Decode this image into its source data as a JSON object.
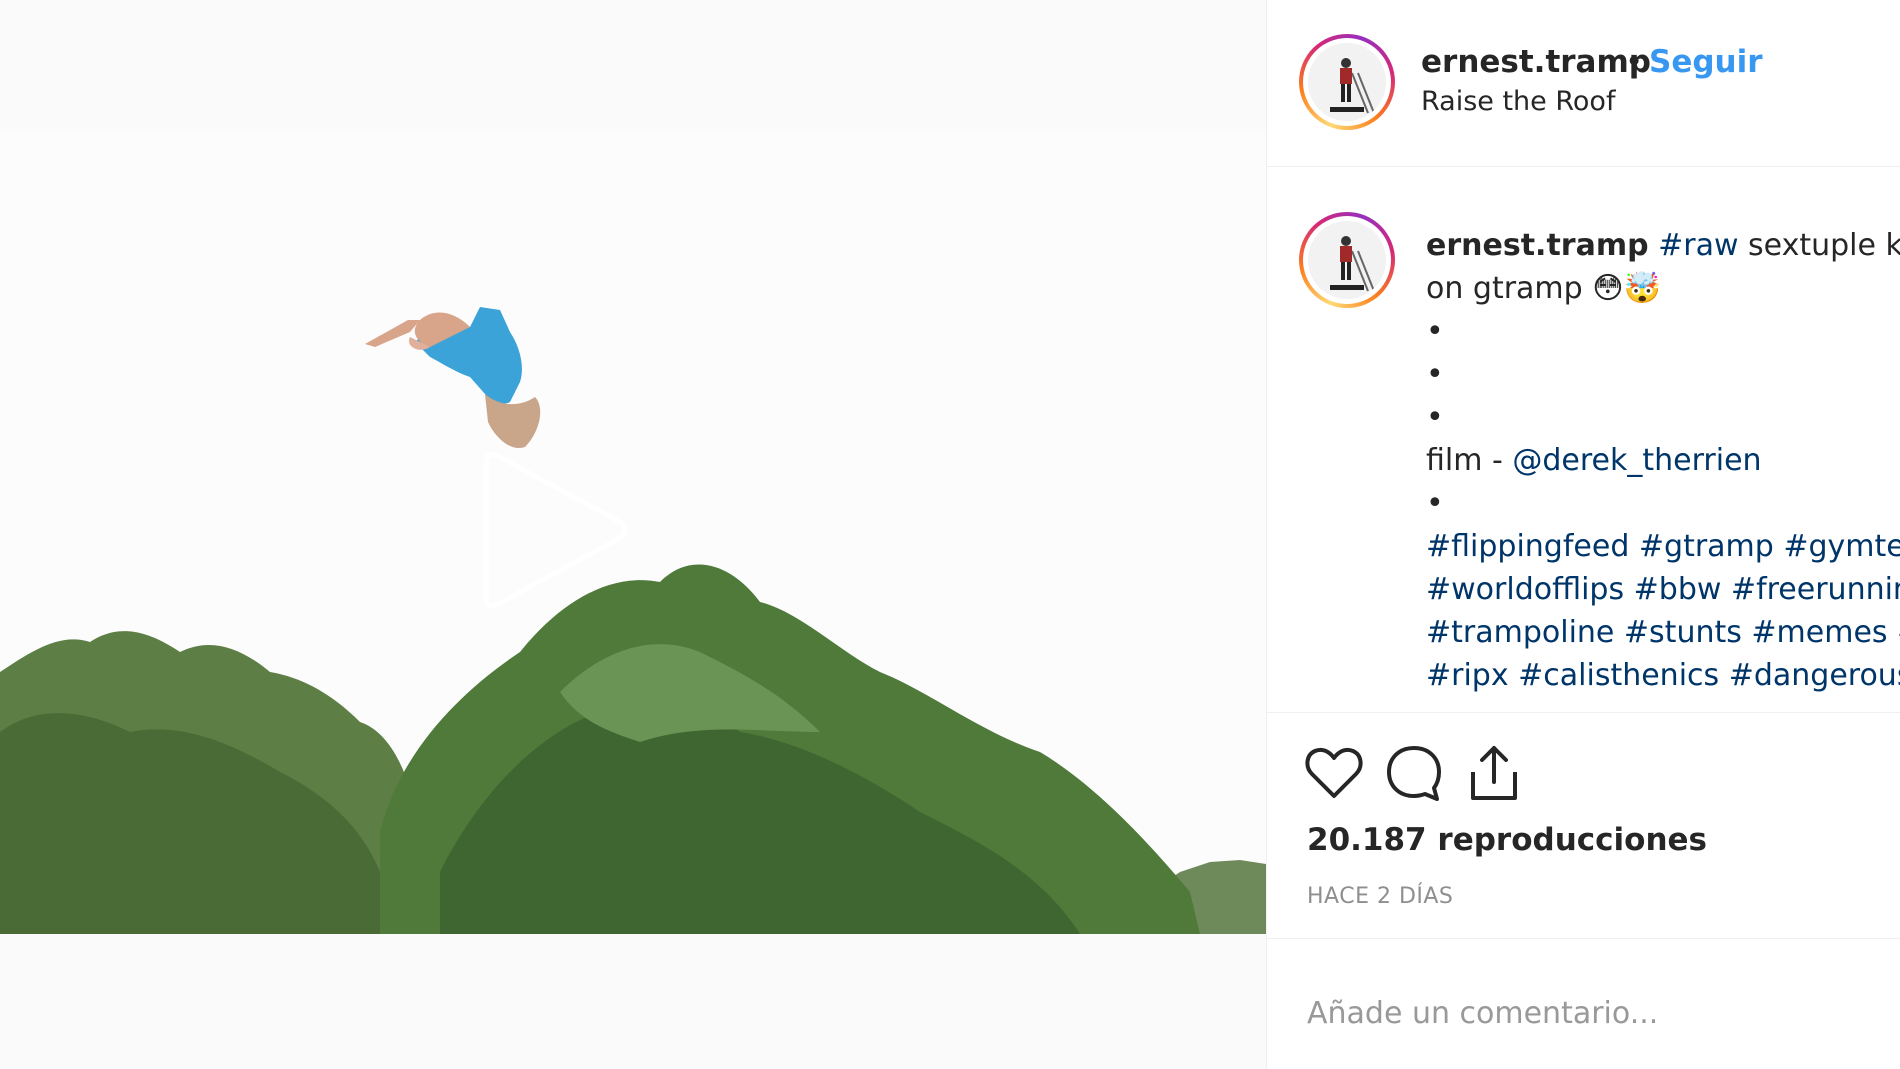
{
  "post": {
    "username": "ernest.tramp",
    "separator": "•",
    "follow_label": "Seguir",
    "location": "Raise the Roof"
  },
  "caption": {
    "username": "ernest.tramp",
    "line1_tag": "#raw",
    "line1_text": " sextuple kabo",
    "line2_text": "on gtramp ",
    "line2_emoji": "😳🤯",
    "bullet": "•",
    "film_prefix": "film - ",
    "film_mention": "@derek_therrien",
    "hashtag_lines": [
      "#flippingfeed #gtramp #gymterr",
      "#worldofflips #bbw #freerunning",
      "#trampoline #stunts #memes #f",
      "#ripx #calisthenics #dangerous"
    ]
  },
  "actions": {
    "like_icon": "heart-icon",
    "comment_icon": "comment-bubble-icon",
    "share_icon": "share-icon"
  },
  "stats": {
    "views": "20.187 reproducciones",
    "time_ago": "HACE 2 DÍAS"
  },
  "comment": {
    "placeholder": "Añade un comentario..."
  },
  "colors": {
    "link_blue": "#3897f0",
    "hashtag": "#003569",
    "text": "#262626",
    "muted": "#8e8e8e"
  }
}
